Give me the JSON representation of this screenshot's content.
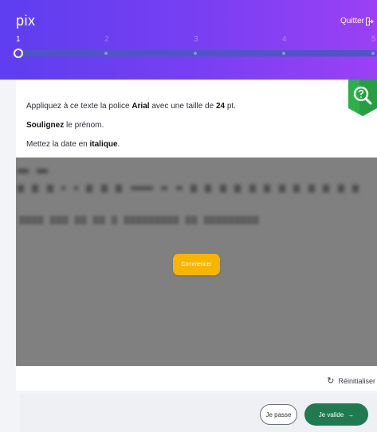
{
  "header": {
    "logo": "pix",
    "quit_label": "Quitter",
    "steps": [
      "1",
      "2",
      "3",
      "4",
      "5"
    ]
  },
  "challenge": {
    "instruction_line1_pre": "Appliquez à ce texte la police ",
    "instruction_line1_font": "Arial",
    "instruction_line1_mid": " avec une taille de ",
    "instruction_line1_size": "24",
    "instruction_line1_post": " pt.",
    "instruction_line2_bold": "Soulignez",
    "instruction_line2_rest": " le prénom.",
    "instruction_line3_pre": "Mettez la date en ",
    "instruction_line3_bold": "italique",
    "instruction_line3_post": ".",
    "embed_start_label": "Commencer",
    "reset_label": "Réinitialiser"
  },
  "footer": {
    "skip_label": "Je passe",
    "validate_label": "Je valide",
    "validate_arrow": "→"
  },
  "colors": {
    "header_gradient_start": "#5d3ef0",
    "header_gradient_end": "#9b40f5",
    "start_button": "#f7b500",
    "validate_button": "#1f7a4f",
    "badge": "#2bb04a"
  },
  "icons": [
    "search-icon",
    "logout-icon",
    "refresh-icon",
    "arrow-right-icon"
  ]
}
